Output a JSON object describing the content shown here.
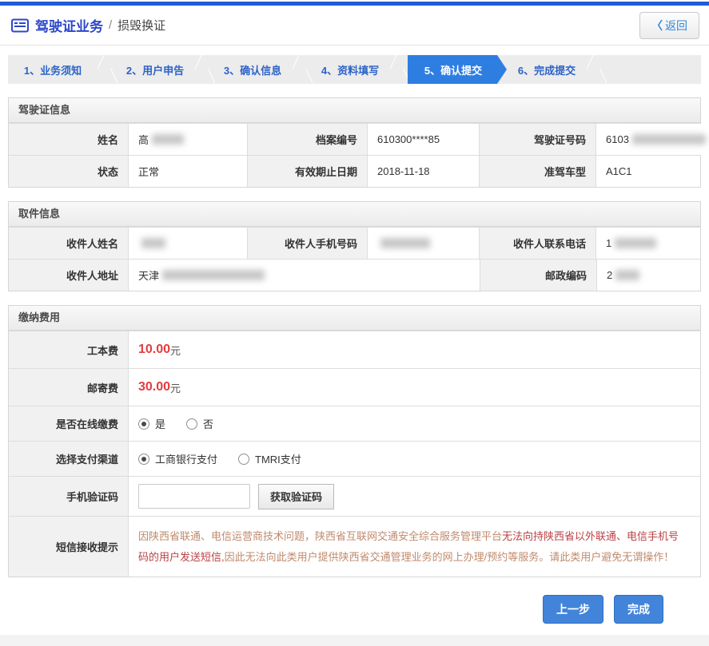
{
  "header": {
    "title": "驾驶证业务",
    "separator": "/",
    "subtitle": "损毁换证",
    "back_chevron": "〈",
    "back_label": "返回"
  },
  "steps": {
    "items": [
      {
        "label": "1、业务须知"
      },
      {
        "label": "2、用户申告"
      },
      {
        "label": "3、确认信息"
      },
      {
        "label": "4、资料填写"
      },
      {
        "label": "5、确认提交"
      },
      {
        "label": "6、完成提交"
      }
    ],
    "active_index": 4,
    "active_color": "#2e7ee2",
    "inactive_text_color": "#2c63c8"
  },
  "license": {
    "title": "驾驶证信息",
    "rows": [
      {
        "cells": [
          {
            "label": "姓名",
            "value": "高"
          },
          {
            "label": "档案编号",
            "value": "610300****85"
          },
          {
            "label": "驾驶证号码",
            "value": "6103"
          }
        ]
      },
      {
        "cells": [
          {
            "label": "状态",
            "value": "正常"
          },
          {
            "label": "有效期止日期",
            "value": "2018-11-18"
          },
          {
            "label": "准驾车型",
            "value": "A1C1"
          }
        ]
      }
    ]
  },
  "pickup": {
    "title": "取件信息",
    "row1": [
      {
        "label": "收件人姓名",
        "value": ""
      },
      {
        "label": "收件人手机号码",
        "value": ""
      },
      {
        "label": "收件人联系电话",
        "value": "1"
      }
    ],
    "address": {
      "label": "收件人地址",
      "value": "天津"
    },
    "postcode": {
      "label": "邮政编码",
      "value": "2"
    }
  },
  "payment": {
    "title": "缴纳费用",
    "fees": [
      {
        "label": "工本费",
        "amount": "10.00",
        "unit": "元"
      },
      {
        "label": "邮寄费",
        "amount": "30.00",
        "unit": "元"
      }
    ],
    "online": {
      "label": "是否在线缴费",
      "options": [
        {
          "label": "是",
          "selected": true
        },
        {
          "label": "否",
          "selected": false
        }
      ]
    },
    "channel": {
      "label": "选择支付渠道",
      "options": [
        {
          "label": "工商银行支付",
          "selected": true
        },
        {
          "label": "TMRI支付",
          "selected": false
        }
      ]
    },
    "code": {
      "label": "手机验证码",
      "input_value": "",
      "button_label": "获取验证码"
    },
    "sms": {
      "label": "短信接收提示",
      "segments": [
        {
          "text": "因陕西省联通、电信运营商技术问题，陕西省互联网交通安全综合服务管理平台",
          "tone": "light"
        },
        {
          "text": "无法向持陕西省以外联通、电信手机号码的用户发送短信,",
          "tone": "dark"
        },
        {
          "text": "因此无法向此类用户提供陕西省交通管理业务的网上办理/预约等服务。请此类用户避免无谓操作！",
          "tone": "light"
        }
      ],
      "light_color": "#c08a6c",
      "dark_color": "#bb4144"
    }
  },
  "actions": {
    "prev_label": "上一步",
    "finish_label": "完成"
  },
  "colors": {
    "topbar": "#1e5cd6",
    "title_blue": "#2d47cc",
    "fee_red": "#e23c3c",
    "button_blue": "#4284d9"
  }
}
